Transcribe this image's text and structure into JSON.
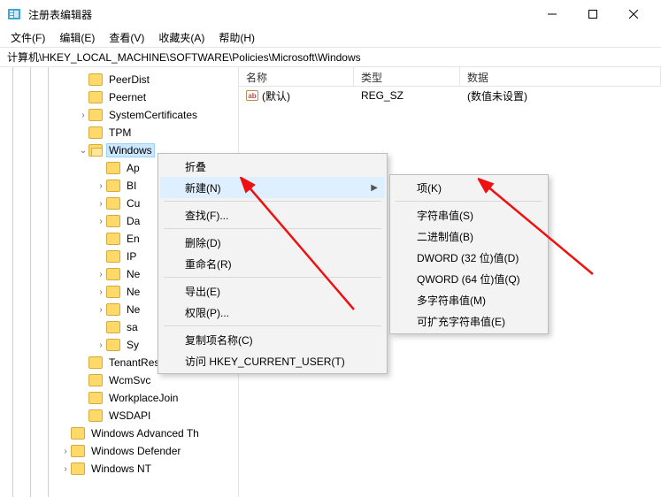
{
  "window": {
    "title": "注册表编辑器"
  },
  "menubar": [
    "文件(F)",
    "编辑(E)",
    "查看(V)",
    "收藏夹(A)",
    "帮助(H)"
  ],
  "address": "计算机\\HKEY_LOCAL_MACHINE\\SOFTWARE\\Policies\\Microsoft\\Windows",
  "tree": {
    "items": [
      {
        "pad": 88,
        "chev": "",
        "open": false,
        "label": "PeerDist"
      },
      {
        "pad": 88,
        "chev": "",
        "open": false,
        "label": "Peernet"
      },
      {
        "pad": 88,
        "chev": "›",
        "open": false,
        "label": "SystemCertificates"
      },
      {
        "pad": 88,
        "chev": "",
        "open": false,
        "label": "TPM"
      },
      {
        "pad": 88,
        "chev": "⌄",
        "open": true,
        "label": "Windows",
        "selected": true
      },
      {
        "pad": 108,
        "chev": "",
        "open": false,
        "label": "Ap"
      },
      {
        "pad": 108,
        "chev": "›",
        "open": false,
        "label": "BI"
      },
      {
        "pad": 108,
        "chev": "›",
        "open": false,
        "label": "Cu"
      },
      {
        "pad": 108,
        "chev": "›",
        "open": false,
        "label": "Da"
      },
      {
        "pad": 108,
        "chev": "",
        "open": false,
        "label": "En"
      },
      {
        "pad": 108,
        "chev": "",
        "open": false,
        "label": "IP"
      },
      {
        "pad": 108,
        "chev": "›",
        "open": false,
        "label": "Ne"
      },
      {
        "pad": 108,
        "chev": "›",
        "open": false,
        "label": "Ne"
      },
      {
        "pad": 108,
        "chev": "›",
        "open": false,
        "label": "Ne"
      },
      {
        "pad": 108,
        "chev": "",
        "open": false,
        "label": "sa"
      },
      {
        "pad": 108,
        "chev": "›",
        "open": false,
        "label": "Sy"
      },
      {
        "pad": 88,
        "chev": "",
        "open": false,
        "label": "TenantRestrictions"
      },
      {
        "pad": 88,
        "chev": "",
        "open": false,
        "label": "WcmSvc"
      },
      {
        "pad": 88,
        "chev": "",
        "open": false,
        "label": "WorkplaceJoin"
      },
      {
        "pad": 88,
        "chev": "",
        "open": false,
        "label": "WSDAPI"
      },
      {
        "pad": 68,
        "chev": "",
        "open": false,
        "label": "Windows Advanced Th"
      },
      {
        "pad": 68,
        "chev": "›",
        "open": false,
        "label": "Windows Defender"
      },
      {
        "pad": 68,
        "chev": "›",
        "open": false,
        "label": "Windows NT"
      }
    ]
  },
  "list": {
    "headers": {
      "name": "名称",
      "type": "类型",
      "data": "数据"
    },
    "row": {
      "name": "(默认)",
      "type": "REG_SZ",
      "data": "(数值未设置)"
    }
  },
  "ctx": {
    "items": [
      {
        "label": "折叠",
        "kind": "item"
      },
      {
        "label": "新建(N)",
        "kind": "sub",
        "hl": true
      },
      {
        "kind": "sep"
      },
      {
        "label": "查找(F)...",
        "kind": "item"
      },
      {
        "kind": "sep"
      },
      {
        "label": "删除(D)",
        "kind": "item"
      },
      {
        "label": "重命名(R)",
        "kind": "item"
      },
      {
        "kind": "sep"
      },
      {
        "label": "导出(E)",
        "kind": "item"
      },
      {
        "label": "权限(P)...",
        "kind": "item"
      },
      {
        "kind": "sep"
      },
      {
        "label": "复制项名称(C)",
        "kind": "item"
      },
      {
        "label": "访问 HKEY_CURRENT_USER(T)",
        "kind": "item"
      }
    ]
  },
  "sub": [
    "项(K)",
    "",
    "字符串值(S)",
    "二进制值(B)",
    "DWORD (32 位)值(D)",
    "QWORD (64 位)值(Q)",
    "多字符串值(M)",
    "可扩充字符串值(E)"
  ]
}
